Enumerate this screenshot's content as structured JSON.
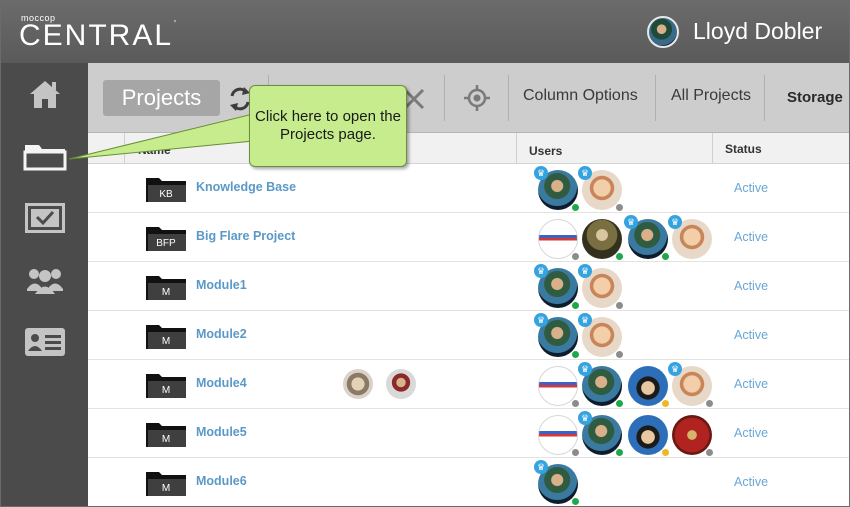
{
  "header": {
    "brand_small": "moccop",
    "brand_big": "CENTRAL",
    "user_name": "Lloyd Dobler"
  },
  "sidebar": {
    "items": [
      {
        "name": "home-icon",
        "active": false
      },
      {
        "name": "folder-icon",
        "active": true
      },
      {
        "name": "checkbox-icon",
        "active": false
      },
      {
        "name": "users-icon",
        "active": false
      },
      {
        "name": "id-card-icon",
        "active": false
      }
    ]
  },
  "toolbar": {
    "projects_label": "Projects",
    "column_options_label": "Column Options",
    "all_projects_label": "All Projects",
    "storage_label": "Storage",
    "icons": [
      "refresh-icon",
      "close-icon",
      "locate-icon"
    ]
  },
  "table": {
    "headers": {
      "name": "Name",
      "users": "Users",
      "status": "Status"
    },
    "rows": [
      {
        "abbr": "KB",
        "name": "Knowledge Base",
        "status": "Active"
      },
      {
        "abbr": "BFP",
        "name": "Big Flare Project",
        "status": "Active"
      },
      {
        "abbr": "M",
        "name": "Module1",
        "status": "Active"
      },
      {
        "abbr": "M",
        "name": "Module2",
        "status": "Active"
      },
      {
        "abbr": "M",
        "name": "Module4",
        "status": "Active"
      },
      {
        "abbr": "M",
        "name": "Module5",
        "status": "Active"
      },
      {
        "abbr": "M",
        "name": "Module6",
        "status": "Active"
      }
    ]
  },
  "callout": {
    "text": "Click here to open the Projects page."
  },
  "colors": {
    "header_bg": "#5f5f5f",
    "sidebar_bg": "#4b4b4b",
    "toolbar_bg": "#cdcdcd",
    "link_blue": "#5a99c7",
    "callout_green": "#c6ec8e",
    "status_green": "#1ea84a",
    "crown_blue": "#35a3e0"
  }
}
